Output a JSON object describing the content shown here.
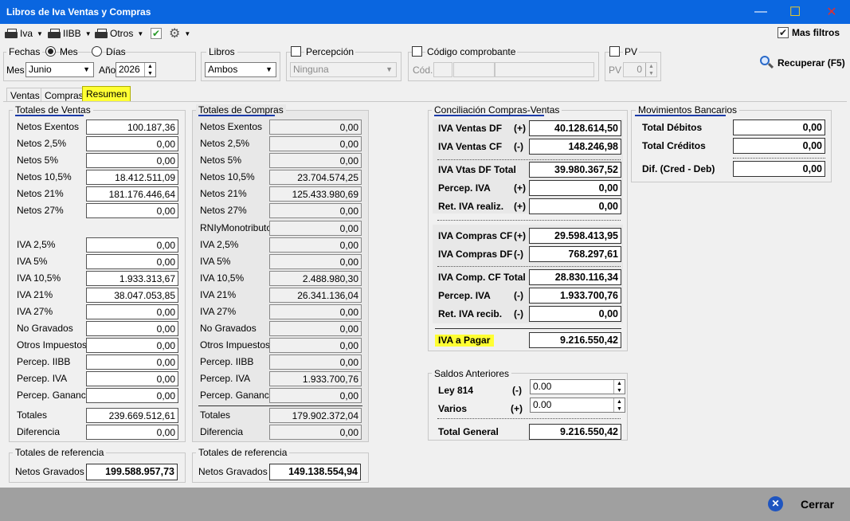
{
  "window": {
    "title": "Libros de Iva Ventas y Compras",
    "minimize": "—",
    "maximize": "☐",
    "close": "✕"
  },
  "toolbar": {
    "iva": "Iva",
    "iibb": "IIBB",
    "otros": "Otros",
    "mas_filtros": "Mas filtros"
  },
  "filters": {
    "fechas_label": "Fechas",
    "mes_radio": "Mes",
    "dias_radio": "Días",
    "mes_label": "Mes",
    "mes_value": "Junio",
    "anio_label": "Año",
    "anio_value": "2026",
    "libros_label": "Libros",
    "libros_value": "Ambos",
    "percepcion_label": "Percepción",
    "percepcion_value": "Ninguna",
    "codigo_label": "Código comprobante",
    "cod_label": "Cód.",
    "pv_group": "PV",
    "pv_label": "PV",
    "pv_value": "0",
    "recuperar": "Recuperar (F5)"
  },
  "tabs": [
    "Ventas",
    "Compras",
    "Resumen"
  ],
  "ventas": {
    "title": "Totales de Ventas",
    "rows": [
      {
        "label": "Netos Exentos",
        "value": "100.187,36"
      },
      {
        "label": "Netos 2,5%",
        "value": "0,00"
      },
      {
        "label": "Netos 5%",
        "value": "0,00"
      },
      {
        "label": "Netos 10,5%",
        "value": "18.412.511,09"
      },
      {
        "label": "Netos 21%",
        "value": "181.176.446,64"
      },
      {
        "label": "Netos 27%",
        "value": "0,00"
      },
      {
        "label": "IVA 2,5%",
        "value": "0,00"
      },
      {
        "label": "IVA 5%",
        "value": "0,00"
      },
      {
        "label": "IVA 10,5%",
        "value": "1.933.313,67"
      },
      {
        "label": "IVA 21%",
        "value": "38.047.053,85"
      },
      {
        "label": "IVA 27%",
        "value": "0,00"
      },
      {
        "label": "No Gravados",
        "value": "0,00"
      },
      {
        "label": "Otros Impuestos",
        "value": "0,00"
      },
      {
        "label": "Percep. IIBB",
        "value": "0,00"
      },
      {
        "label": "Percep. IVA",
        "value": "0,00"
      },
      {
        "label": "Percep. Gananc.",
        "value": "0,00"
      },
      {
        "label": "Totales",
        "value": "239.669.512,61"
      },
      {
        "label": "Diferencia",
        "value": "0,00"
      }
    ],
    "ref_title": "Totales de referencia",
    "ref_label": "Netos Gravados",
    "ref_value": "199.588.957,73"
  },
  "compras": {
    "title": "Totales de Compras",
    "rows": [
      {
        "label": "Netos Exentos",
        "value": "0,00"
      },
      {
        "label": "Netos 2,5%",
        "value": "0,00"
      },
      {
        "label": "Netos 5%",
        "value": "0,00"
      },
      {
        "label": "Netos 10,5%",
        "value": "23.704.574,25"
      },
      {
        "label": "Netos 21%",
        "value": "125.433.980,69"
      },
      {
        "label": "Netos 27%",
        "value": "0,00"
      },
      {
        "label": "RNIyMonotributo",
        "value": "0,00"
      },
      {
        "label": "IVA 2,5%",
        "value": "0,00"
      },
      {
        "label": "IVA 5%",
        "value": "0,00"
      },
      {
        "label": "IVA 10,5%",
        "value": "2.488.980,30"
      },
      {
        "label": "IVA 21%",
        "value": "26.341.136,04"
      },
      {
        "label": "IVA 27%",
        "value": "0,00"
      },
      {
        "label": "No Gravados",
        "value": "0,00"
      },
      {
        "label": "Otros Impuestos",
        "value": "0,00"
      },
      {
        "label": "Percep. IIBB",
        "value": "0,00"
      },
      {
        "label": "Percep. IVA",
        "value": "1.933.700,76"
      },
      {
        "label": "Percep. Gananc.",
        "value": "0,00"
      },
      {
        "label": "Totales",
        "value": "179.902.372,04"
      },
      {
        "label": "Diferencia",
        "value": "0,00"
      }
    ],
    "ref_title": "Totales de referencia",
    "ref_label": "Netos Gravados",
    "ref_value": "149.138.554,94"
  },
  "conciliacion": {
    "title": "Conciliación Compras-Ventas",
    "rows": [
      {
        "label": "IVA Ventas DF",
        "sign": "(+)",
        "value": "40.128.614,50"
      },
      {
        "label": "IVA Ventas CF",
        "sign": "(-)",
        "value": "148.246,98"
      },
      {
        "label": "IVA Vtas DF Total",
        "sign": "",
        "value": "39.980.367,52"
      },
      {
        "label": "Percep. IVA",
        "sign": "(+)",
        "value": "0,00"
      },
      {
        "label": "Ret. IVA realiz.",
        "sign": "(+)",
        "value": "0,00"
      },
      {
        "label": "IVA Compras CF",
        "sign": "(+)",
        "value": "29.598.413,95"
      },
      {
        "label": "IVA Compras DF",
        "sign": "(-)",
        "value": "768.297,61"
      },
      {
        "label": "IVA Comp. CF Total",
        "sign": "",
        "value": "28.830.116,34"
      },
      {
        "label": "Percep. IVA",
        "sign": "(-)",
        "value": "1.933.700,76"
      },
      {
        "label": "Ret. IVA recib.",
        "sign": "(-)",
        "value": "0,00"
      }
    ],
    "pagar_label": "IVA a Pagar",
    "pagar_value": "9.216.550,42"
  },
  "saldos": {
    "title": "Saldos Anteriores",
    "ley_label": "Ley 814",
    "ley_sign": "(-)",
    "ley_value": "0.00",
    "varios_label": "Varios",
    "varios_sign": "(+)",
    "varios_value": "0.00",
    "total_label": "Total General",
    "total_value": "9.216.550,42"
  },
  "movimientos": {
    "title": "Movimientos Bancarios",
    "debitos_label": "Total Débitos",
    "debitos_value": "0,00",
    "creditos_label": "Total Créditos",
    "creditos_value": "0,00",
    "dif_label": "Dif. (Cred - Deb)",
    "dif_value": "0,00"
  },
  "footer": {
    "cerrar": "Cerrar"
  },
  "colors": {
    "titlebar": "#0a66e0",
    "highlight": "#ffff33",
    "underline": "#1a3aa8"
  }
}
